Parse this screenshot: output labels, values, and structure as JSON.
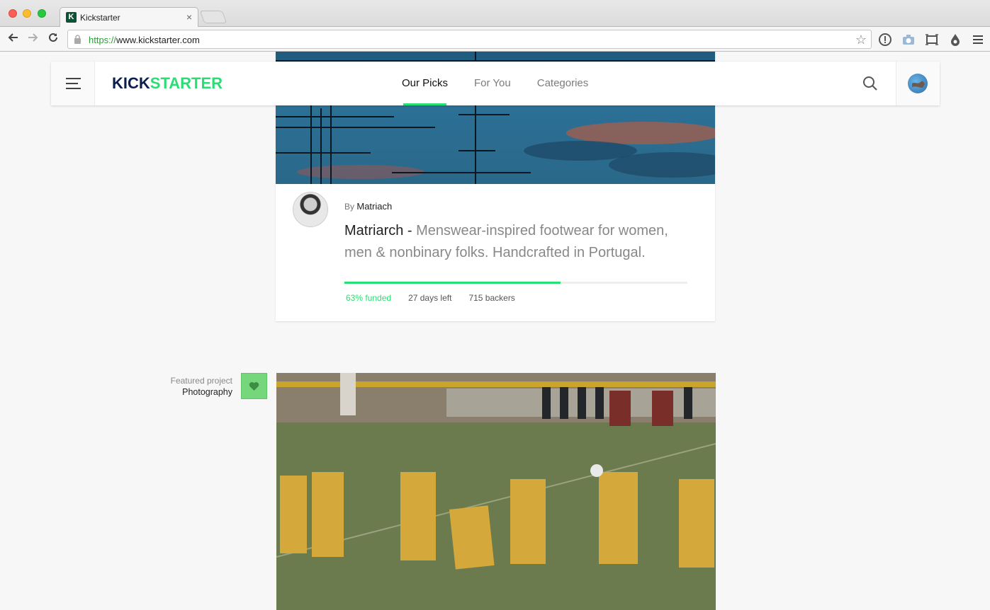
{
  "browser": {
    "tab_title": "Kickstarter",
    "tab_favicon_letter": "K",
    "tab_close": "×",
    "url_scheme": "https://",
    "url_host": "www.kickstarter.com"
  },
  "header": {
    "logo_kick": "KICK",
    "logo_starter": "STARTER",
    "nav": [
      {
        "label": "Our Picks",
        "active": true
      },
      {
        "label": "For You",
        "active": false
      },
      {
        "label": "Categories",
        "active": false
      }
    ]
  },
  "project": {
    "by_prefix": "By",
    "creator": "Matriach",
    "name": "Matriarch -",
    "description": " Menswear-inspired footwear for women, men & nonbinary folks. Handcrafted in Portugal.",
    "funded_percent": 63,
    "funded_text": "63% funded",
    "days_left": "27 days left",
    "backers": "715 backers"
  },
  "featured": {
    "label": "Featured project",
    "category": "Photography"
  },
  "colors": {
    "brand_green": "#2bde73",
    "brand_navy": "#0b1f4f",
    "heart_green": "#75d67c"
  }
}
